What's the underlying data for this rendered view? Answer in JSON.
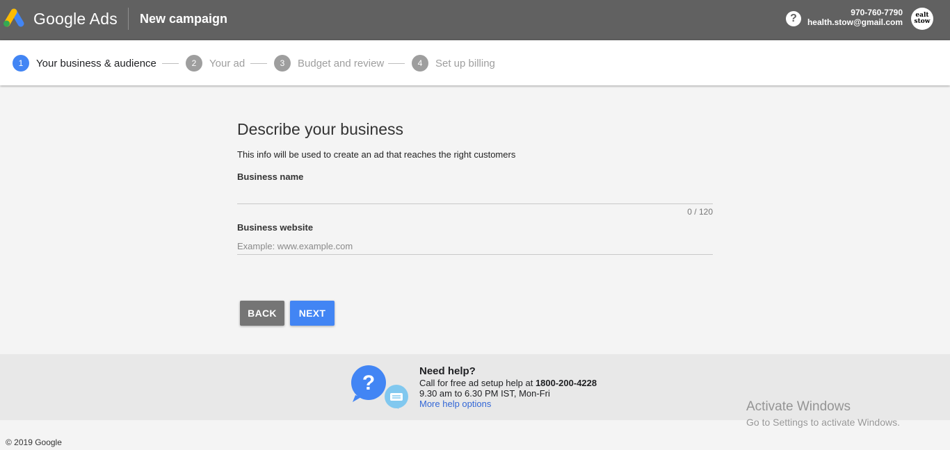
{
  "header": {
    "product_name": "Google Ads",
    "page_title": "New campaign",
    "help_icon_glyph": "?",
    "account": {
      "phone": "970-760-7790",
      "email": "health.stow@gmail.com",
      "avatar_lines": [
        "ealt",
        "stow"
      ]
    }
  },
  "stepper": {
    "steps": [
      {
        "number": "1",
        "label": "Your business & audience",
        "state": "active"
      },
      {
        "number": "2",
        "label": "Your ad",
        "state": "inactive"
      },
      {
        "number": "3",
        "label": "Budget and review",
        "state": "inactive"
      },
      {
        "number": "4",
        "label": "Set up billing",
        "state": "inactive"
      }
    ]
  },
  "form": {
    "title": "Describe your business",
    "description": "This info will be used to create an ad that reaches the right customers",
    "business_name": {
      "label": "Business name",
      "value": "",
      "placeholder": "",
      "counter": "0 / 120"
    },
    "business_website": {
      "label": "Business website",
      "value": "",
      "placeholder": "Example: www.example.com"
    },
    "back_label": "BACK",
    "next_label": "NEXT"
  },
  "help": {
    "title": "Need help?",
    "call_text": "Call for free ad setup help at ",
    "phone": "1800-200-4228",
    "hours": "9.30 am to 6.30 PM IST, Mon-Fri",
    "link_label": "More help options",
    "icon_glyph": "?"
  },
  "watermark": {
    "title": "Activate Windows",
    "subtitle": "Go to Settings to activate Windows."
  },
  "footer": {
    "copyright": "© 2019 Google"
  },
  "colors": {
    "topbar": "#616161",
    "accent": "#4285f4",
    "step_inactive": "#9e9e9e",
    "back_button": "#757575",
    "link": "#3367d6"
  }
}
